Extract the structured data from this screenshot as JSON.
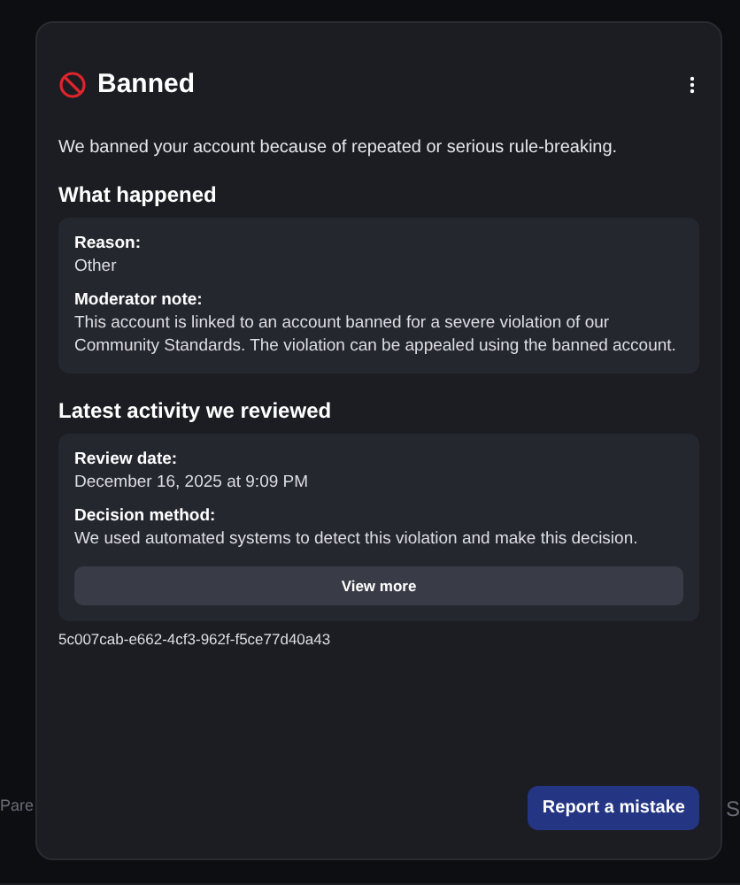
{
  "background_left": "Pare",
  "background_right": "S",
  "dialog": {
    "title": "Banned",
    "intro": "We banned your account because of repeated or serious rule-breaking.",
    "sections": [
      {
        "heading": "What happened",
        "fields": [
          {
            "label": "Reason:",
            "value": "Other"
          },
          {
            "label": "Moderator note:",
            "value": "This account is linked to an account banned for a severe violation of our Community Standards. The violation can be appealed using the banned account."
          }
        ]
      },
      {
        "heading": "Latest activity we reviewed",
        "fields": [
          {
            "label": "Review date:",
            "value": "December 16, 2025 at 9:09 PM"
          },
          {
            "label": "Decision method:",
            "value": "We used automated systems to detect this violation and make this decision."
          }
        ],
        "button": "View more"
      }
    ],
    "reference_id": "5c007cab-e662-4cf3-962f-f5ce77d40a43",
    "primary_button": "Report a mistake"
  }
}
